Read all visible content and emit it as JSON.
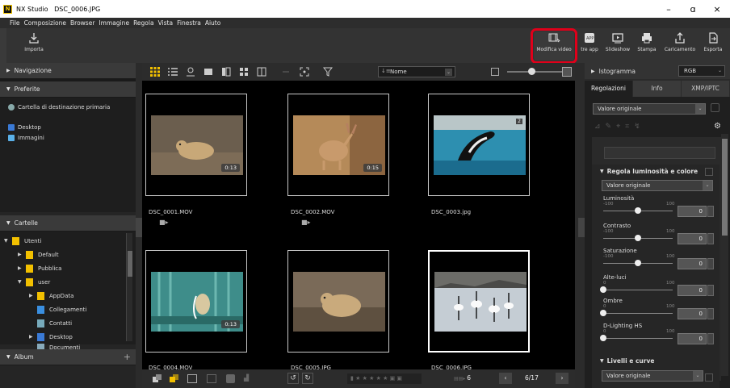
{
  "window": {
    "app_name": "NX Studio",
    "file": "DSC_0006.JPG",
    "minimize": "–",
    "maximize": "ɑ",
    "close": "×"
  },
  "menu": [
    "File",
    "Composizione",
    "Browser",
    "Immagine",
    "Regola",
    "Vista",
    "Finestra",
    "Aiuto"
  ],
  "toolbar": {
    "import": "Importa",
    "edit_video": "Modifica video",
    "other_apps": "tre app",
    "slideshow": "Slideshow",
    "print": "Stampa",
    "upload": "Caricamento",
    "export": "Esporta"
  },
  "left": {
    "navigation": "Navigazione",
    "favorites": "Preferite",
    "fav_items": [
      "Cartella di destinazione primaria",
      "Desktop",
      "Immagini"
    ],
    "folders": "Cartelle",
    "tree": [
      "Utenti",
      "Default",
      "Pubblica",
      "user",
      "AppData",
      "Collegamenti",
      "Contatti",
      "Desktop",
      "Documenti"
    ],
    "album": "Album",
    "album_add": "+"
  },
  "browser": {
    "sort_label": "Nome",
    "thumbs": [
      {
        "name": "DSC_0001.MOV",
        "duration": "0:13",
        "video": true
      },
      {
        "name": "DSC_0002.MOV",
        "duration": "0:15",
        "video": true
      },
      {
        "name": "DSC_0003.jpg",
        "duration": "",
        "video": false
      },
      {
        "name": "DSC_0004.MOV",
        "duration": "0:13",
        "video": true
      },
      {
        "name": "DSC_0005.JPG",
        "duration": "",
        "video": false
      },
      {
        "name": "DSC_0006.JPG",
        "duration": "",
        "video": false
      }
    ],
    "badge_3": "2",
    "page_current": "6",
    "page_label": "6/17"
  },
  "right": {
    "histogram": "Istogramma",
    "rgb": "RGB",
    "tabs": [
      "Regolazioni",
      "Info",
      "XMP/IPTC"
    ],
    "preset": "Valore originale",
    "brightness_section": "Regola luminosità e colore",
    "brightness_preset": "Valore originale",
    "sliders": [
      {
        "label": "Luminosità",
        "min": "-100",
        "max": "100",
        "value": "0",
        "level": 0.5
      },
      {
        "label": "Contrasto",
        "min": "-100",
        "max": "100",
        "value": "0",
        "level": 0.5
      },
      {
        "label": "Saturazione",
        "min": "-100",
        "max": "100",
        "value": "0",
        "level": 0.5
      },
      {
        "label": "Alte-luci",
        "min": "0",
        "max": "100",
        "value": "0",
        "level": 0
      },
      {
        "label": "Ombre",
        "min": "0",
        "max": "100",
        "value": "0",
        "level": 0
      },
      {
        "label": "D-Lighting HS",
        "min": "0",
        "max": "100",
        "value": "0",
        "level": 0
      }
    ],
    "levels_section": "Livelli e curve",
    "levels_preset": "Valore originale"
  }
}
